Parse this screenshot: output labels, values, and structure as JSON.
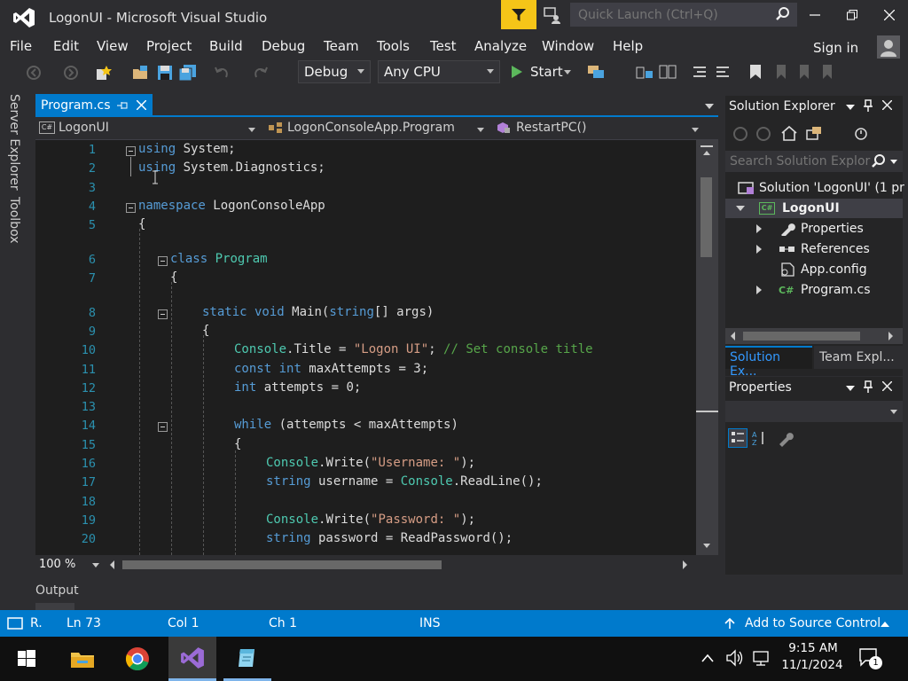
{
  "window": {
    "title": "LogonUI - Microsoft Visual Studio",
    "quick_launch_placeholder": "Quick Launch (Ctrl+Q)"
  },
  "menu": [
    "File",
    "Edit",
    "View",
    "Project",
    "Build",
    "Debug",
    "Team",
    "Tools",
    "Test",
    "Analyze",
    "Window",
    "Help"
  ],
  "account": {
    "sign_in": "Sign in"
  },
  "toolbar": {
    "configuration": "Debug",
    "platform": "Any CPU",
    "start_label": "Start"
  },
  "left_tabs": [
    "Server Explorer",
    "Toolbox"
  ],
  "editor": {
    "tab_label": "Program.cs",
    "nav_project": "LogonUI",
    "nav_class": "LogonConsoleApp.Program",
    "nav_member": "RestartPC()",
    "zoom": "100 %",
    "line_numbers": [
      "1",
      "2",
      "3",
      "4",
      "5",
      "6",
      "7",
      "8",
      "9",
      "10",
      "11",
      "12",
      "13",
      "14",
      "15",
      "16",
      "17",
      "18",
      "19",
      "20"
    ],
    "code": {
      "l1_kw": "using",
      "l1_rest": " System;",
      "l2_kw": "using",
      "l2_rest": " System.Diagnostics;",
      "l4_kw": "namespace",
      "l4_rest": " LogonConsoleApp",
      "l5": "{",
      "l6_kw": "class",
      "l6_ty": " Program",
      "l7": "{",
      "l8_kw1": "static",
      "l8_kw2": " void",
      "l8_a": " Main(",
      "l8_kw3": "string",
      "l8_b": "[] args)",
      "l9": "{",
      "l10_ty": "Console",
      "l10_a": ".Title = ",
      "l10_st": "\"Logon UI\"",
      "l10_b": "; ",
      "l10_cm": "// Set console title",
      "l11_kw1": "const",
      "l11_kw2": " int",
      "l11_a": " maxAttempts = 3;",
      "l12_kw": "int",
      "l12_a": " attempts = 0;",
      "l14_kw": "while",
      "l14_a": " (attempts < maxAttempts)",
      "l15": "{",
      "l16_ty": "Console",
      "l16_a": ".Write(",
      "l16_st": "\"Username: \"",
      "l16_b": ");",
      "l17_kw": "string",
      "l17_a": " username = ",
      "l17_ty": "Console",
      "l17_b": ".ReadLine();",
      "l19_ty": "Console",
      "l19_a": ".Write(",
      "l19_st": "\"Password: \"",
      "l19_b": ");",
      "l20_kw": "string",
      "l20_a": " password = ReadPassword();"
    }
  },
  "output": {
    "label": "Output"
  },
  "solution_explorer": {
    "title": "Solution Explorer",
    "search_placeholder": "Search Solution Explor",
    "solution": "Solution 'LogonUI' (1 pr",
    "project": "LogonUI",
    "items": [
      "Properties",
      "References",
      "App.config",
      "Program.cs"
    ],
    "tab_active": "Solution Ex...",
    "tab_other": "Team Expl..."
  },
  "properties": {
    "title": "Properties"
  },
  "status": {
    "ready": "R.",
    "ln": "Ln 73",
    "col": "Col 1",
    "ch": "Ch 1",
    "ins": "INS",
    "source_control": "Add to Source Control"
  },
  "taskbar": {
    "time": "9:15 AM",
    "date": "11/1/2024",
    "notifications": "1"
  },
  "colors": {
    "accent": "#007acc",
    "filter": "#f5c518",
    "keyword": "#569cd6",
    "type": "#4ec9b0",
    "string": "#d69d85",
    "comment": "#57a64a"
  }
}
